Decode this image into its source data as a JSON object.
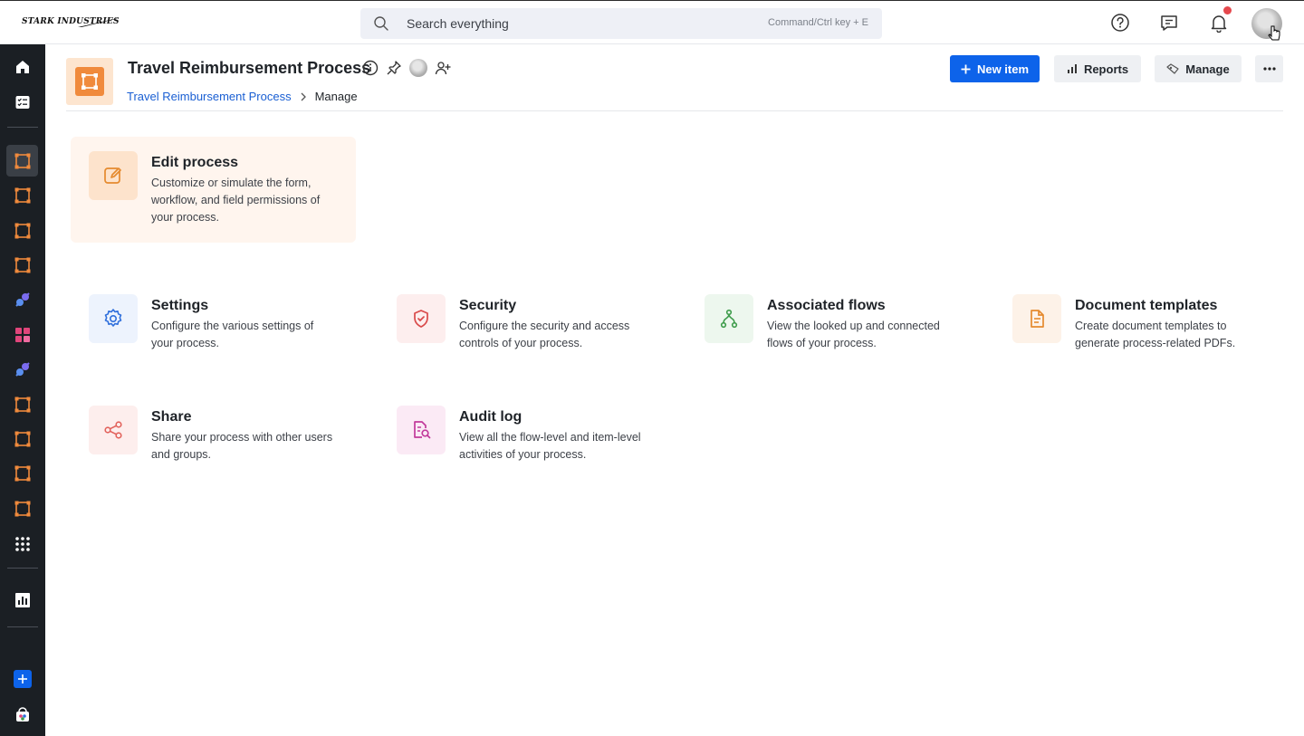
{
  "brand": {
    "logo_text": "STARK INDUSTRIES"
  },
  "search": {
    "placeholder": "Search everything",
    "shortcut_hint": "Command/Ctrl key + E"
  },
  "header": {
    "title": "Travel Reimbursement Process",
    "breadcrumb": {
      "parent": "Travel Reimbursement Process",
      "current": "Manage"
    },
    "buttons": {
      "new_item": "New item",
      "reports": "Reports",
      "manage": "Manage"
    }
  },
  "featured": {
    "title": "Edit process",
    "description": "Customize or simulate the form, workflow, and field permissions of your process."
  },
  "cards": [
    {
      "title": "Settings",
      "description": "Configure the various settings of your process.",
      "icon": "gear-icon"
    },
    {
      "title": "Security",
      "description": "Configure the security and access controls of your process.",
      "icon": "shield-icon"
    },
    {
      "title": "Associated flows",
      "description": "View the looked up and connected flows of your process.",
      "icon": "flows-icon"
    },
    {
      "title": "Document templates",
      "description": "Create document templates to generate process-related PDFs.",
      "icon": "document-icon"
    },
    {
      "title": "Share",
      "description": "Share your process with other users and groups.",
      "icon": "share-icon"
    },
    {
      "title": "Audit log",
      "description": "View all the flow-level and item-level activities of your process.",
      "icon": "audit-icon"
    }
  ],
  "colors": {
    "primary": "#0d63ea",
    "sidebar": "#1b1f24",
    "process_orange": "#f08a3c",
    "settings_blue": "#2f6fdc",
    "security_red": "#d94a4a",
    "flows_green": "#3e9c4b",
    "document_orange": "#e58a2e",
    "share_red": "#e2615b",
    "audit_pink": "#c23a9b"
  }
}
